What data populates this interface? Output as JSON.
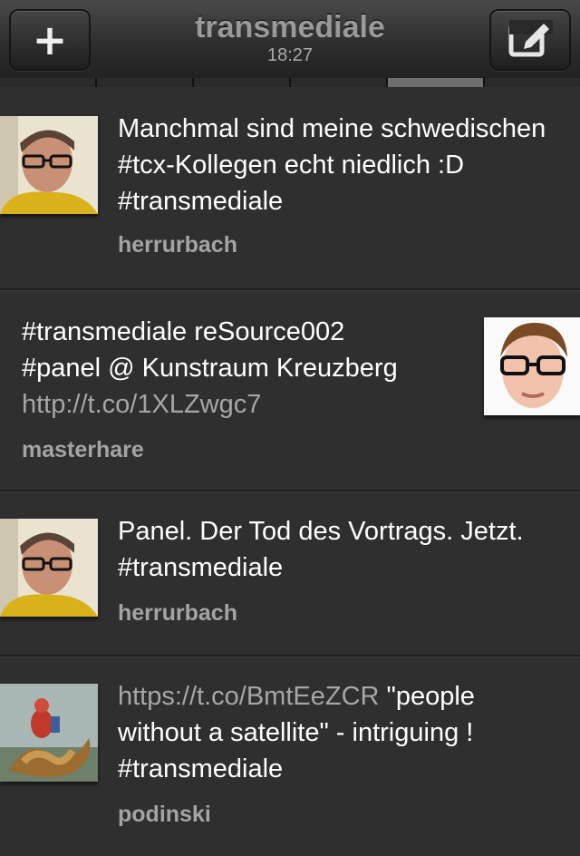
{
  "header": {
    "title": "transmediale",
    "time": "18:27"
  },
  "tweets": [
    {
      "text": "Manchmal sind meine schwedischen #tcx-Kollegen echt niedlich :D #transmediale",
      "author": "herrurbach"
    },
    {
      "line1": "#transmediale reSource002",
      "line2": "#panel  @ Kunstraum Kreuzberg",
      "link": "http://t.co/1XLZwgc7",
      "author": "masterhare"
    },
    {
      "text": "Panel. Der Tod des Vortrags. Jetzt. #transmediale",
      "author": "herrurbach"
    },
    {
      "link": "https://t.co/BmtEeZCR",
      "text_after_link": " \"people without a satellite\" - intriguing ! #transmediale",
      "author": "podinski"
    }
  ]
}
